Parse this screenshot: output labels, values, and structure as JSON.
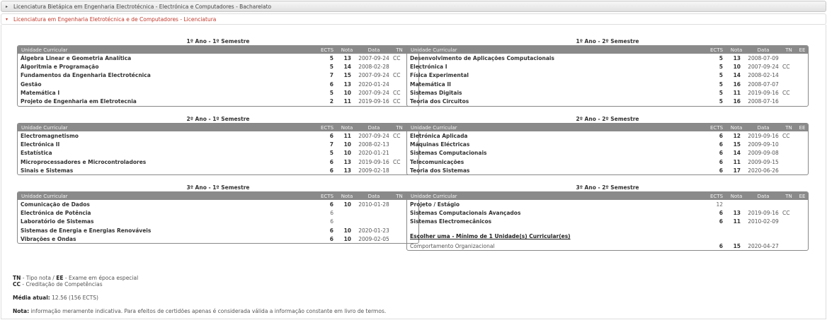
{
  "accordion": [
    {
      "label": "Licenciatura Bietápica em Engenharia Electrotécnica - Electrónica e Computadores - Bacharelato",
      "arrow": "▸"
    },
    {
      "label": "Licenciatura em Engenharia Eletrotécnica e de Computadores - Licenciatura",
      "arrow": "▾"
    }
  ],
  "headers": {
    "uc": "Unidade Curricular",
    "ects": "ECTS",
    "nota": "Nota",
    "data": "Data",
    "tn": "TN",
    "ee": "EE"
  },
  "semesters": [
    {
      "title": "1º Ano - 1º Semestre",
      "rows": [
        {
          "uc": "Álgebra Linear e Geometria Analítica",
          "ects": "5",
          "nota": "13",
          "data": "2007-09-24",
          "tn": "CC",
          "ee": ""
        },
        {
          "uc": "Algoritmia e Programação",
          "ects": "5",
          "nota": "14",
          "data": "2008-02-28",
          "tn": "",
          "ee": ""
        },
        {
          "uc": "Fundamentos da Engenharia Electrotécnica",
          "ects": "7",
          "nota": "15",
          "data": "2007-09-24",
          "tn": "CC",
          "ee": ""
        },
        {
          "uc": "Gestão",
          "ects": "6",
          "nota": "13",
          "data": "2020-01-24",
          "tn": "",
          "ee": ""
        },
        {
          "uc": "Matemática I",
          "ects": "5",
          "nota": "10",
          "data": "2007-09-24",
          "tn": "CC",
          "ee": ""
        },
        {
          "uc": "Projeto de Engenharia em Eletrotecnia",
          "ects": "2",
          "nota": "11",
          "data": "2019-09-16",
          "tn": "CC",
          "ee": ""
        }
      ]
    },
    {
      "title": "1º Ano - 2º Semestre",
      "rows": [
        {
          "uc": "Desenvolvimento de Aplicações Computacionais",
          "ects": "5",
          "nota": "13",
          "data": "2008-07-09",
          "tn": "",
          "ee": ""
        },
        {
          "uc": "Electrónica I",
          "ects": "5",
          "nota": "10",
          "data": "2007-09-24",
          "tn": "CC",
          "ee": ""
        },
        {
          "uc": "Física Experimental",
          "ects": "5",
          "nota": "14",
          "data": "2008-02-14",
          "tn": "",
          "ee": ""
        },
        {
          "uc": "Matemática II",
          "ects": "5",
          "nota": "16",
          "data": "2008-07-07",
          "tn": "",
          "ee": ""
        },
        {
          "uc": "Sistemas Digitais",
          "ects": "5",
          "nota": "11",
          "data": "2019-09-16",
          "tn": "CC",
          "ee": ""
        },
        {
          "uc": "Teoria dos Circuitos",
          "ects": "5",
          "nota": "16",
          "data": "2008-07-16",
          "tn": "",
          "ee": ""
        }
      ]
    },
    {
      "title": "2º Ano - 1º Semestre",
      "rows": [
        {
          "uc": "Electromagnetismo",
          "ects": "6",
          "nota": "11",
          "data": "2007-09-24",
          "tn": "CC",
          "ee": ""
        },
        {
          "uc": "Electrónica II",
          "ects": "7",
          "nota": "10",
          "data": "2008-02-13",
          "tn": "",
          "ee": ""
        },
        {
          "uc": "Estatística",
          "ects": "5",
          "nota": "10",
          "data": "2020-01-21",
          "tn": "",
          "ee": ""
        },
        {
          "uc": "Microprocessadores e Microcontroladores",
          "ects": "6",
          "nota": "13",
          "data": "2019-09-16",
          "tn": "CC",
          "ee": ""
        },
        {
          "uc": "Sinais e Sistemas",
          "ects": "6",
          "nota": "13",
          "data": "2009-02-18",
          "tn": "",
          "ee": ""
        }
      ]
    },
    {
      "title": "2º Ano - 2º Semestre",
      "rows": [
        {
          "uc": "Eletrónica Aplicada",
          "ects": "6",
          "nota": "12",
          "data": "2019-09-16",
          "tn": "CC",
          "ee": ""
        },
        {
          "uc": "Máquinas Eléctricas",
          "ects": "6",
          "nota": "15",
          "data": "2009-09-10",
          "tn": "",
          "ee": ""
        },
        {
          "uc": "Sistemas Computacionais",
          "ects": "6",
          "nota": "14",
          "data": "2009-09-08",
          "tn": "",
          "ee": ""
        },
        {
          "uc": "Telecomunicações",
          "ects": "6",
          "nota": "11",
          "data": "2009-09-15",
          "tn": "",
          "ee": ""
        },
        {
          "uc": "Teoria dos Sistemas",
          "ects": "6",
          "nota": "17",
          "data": "2020-06-26",
          "tn": "",
          "ee": ""
        }
      ]
    },
    {
      "title": "3º Ano - 1º Semestre",
      "rows": [
        {
          "uc": "Comunicação de Dados",
          "ects": "6",
          "nota": "10",
          "data": "2010-01-28",
          "tn": "",
          "ee": ""
        },
        {
          "uc": "Electrónica de Potência",
          "ects": "6",
          "nota": "",
          "data": "",
          "tn": "",
          "ee": ""
        },
        {
          "uc": "Laboratório de Sistemas",
          "ects": "6",
          "nota": "",
          "data": "",
          "tn": "",
          "ee": ""
        },
        {
          "uc": "Sistemas de Energia e Energias Renováveis",
          "ects": "6",
          "nota": "10",
          "data": "2020-01-23",
          "tn": "",
          "ee": ""
        },
        {
          "uc": "Vibrações e Ondas",
          "ects": "6",
          "nota": "10",
          "data": "2009-02-05",
          "tn": "",
          "ee": ""
        }
      ]
    },
    {
      "title": "3º Ano - 2º Semestre",
      "rows": [
        {
          "uc": "Projeto / Estágio",
          "ects": "12",
          "nota": "",
          "data": "",
          "tn": "",
          "ee": ""
        },
        {
          "uc": "Sistemas Computacionais Avançados",
          "ects": "6",
          "nota": "13",
          "data": "2019-09-16",
          "tn": "CC",
          "ee": ""
        },
        {
          "uc": "Sistemas Electromecânicos",
          "ects": "6",
          "nota": "11",
          "data": "2010-02-09",
          "tn": "",
          "ee": ""
        }
      ],
      "group_title": "Escolher uma - Mínimo de 1 Unidade(s) Curricular(es)",
      "group_rows": [
        {
          "uc": "Comportamento Organizacional",
          "ects": "6",
          "nota": "15",
          "data": "2020-04-27",
          "tn": "",
          "ee": ""
        }
      ]
    }
  ],
  "legend": {
    "tn_key": "TN",
    "tn_text": " - Tipo nota / ",
    "ee_key": "EE",
    "ee_text": " - Exame em época especial",
    "cc_key": "CC",
    "cc_text": " - Creditação de Competências"
  },
  "media": {
    "label": "Média atual:",
    "value": " 12.56 (156 ECTS)"
  },
  "nota": {
    "label": "Nota:",
    "text": " informação meramente indicativa. Para efeitos de certidões apenas é considerada válida a informação constante em livro de termos."
  }
}
